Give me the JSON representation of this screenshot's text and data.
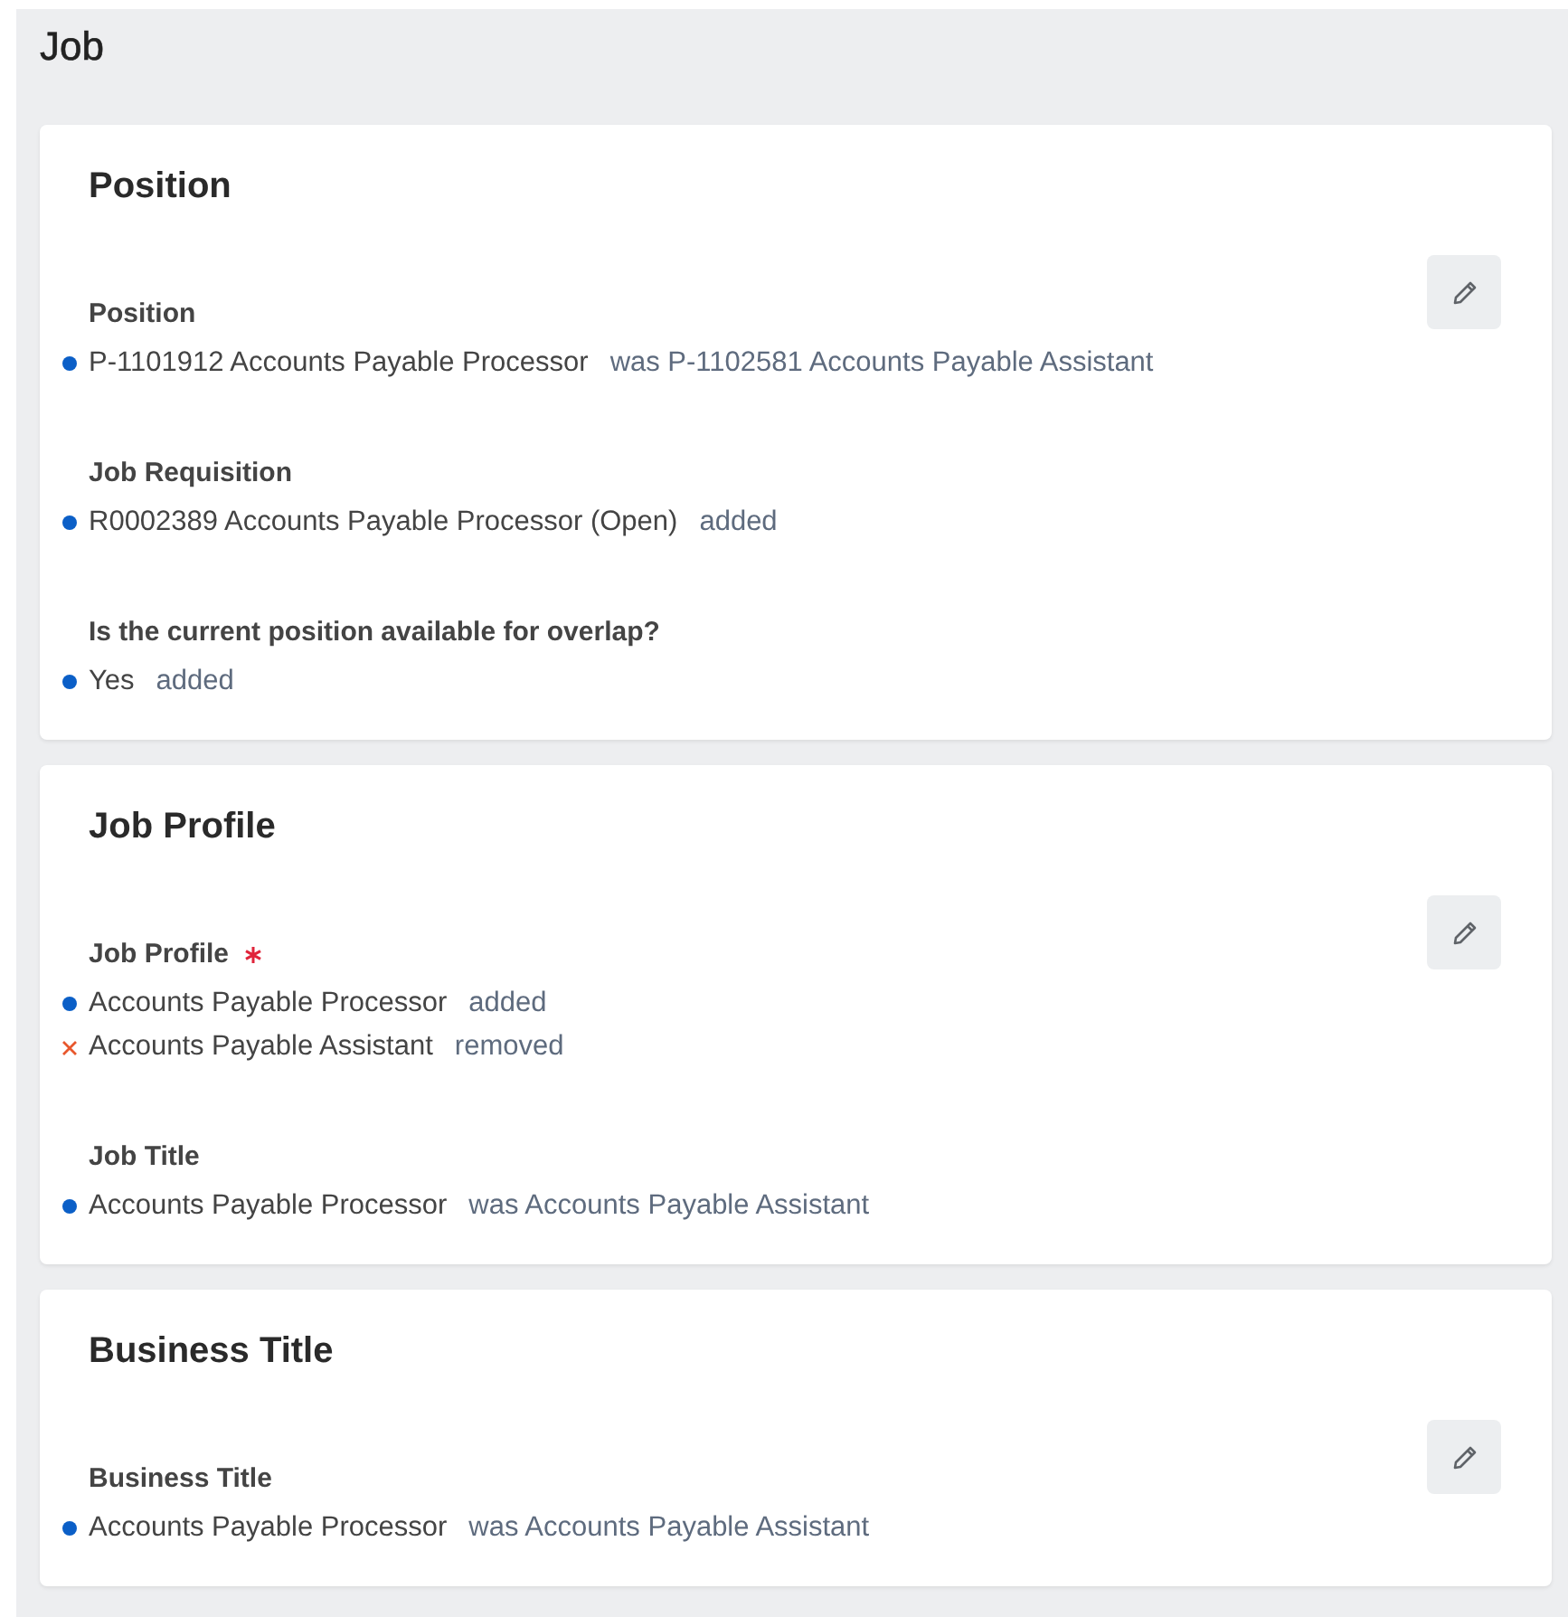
{
  "page_title": "Job",
  "sections": [
    {
      "title": "Position",
      "fields": [
        {
          "label": "Position",
          "required": false,
          "values": [
            {
              "kind": "changed",
              "value": "P-1101912 Accounts Payable Processor",
              "note": "was P-1102581 Accounts Payable Assistant"
            }
          ]
        },
        {
          "label": "Job Requisition",
          "required": false,
          "values": [
            {
              "kind": "changed",
              "value": "R0002389 Accounts Payable Processor (Open)",
              "note": "added"
            }
          ]
        },
        {
          "label": "Is the current position available for overlap?",
          "required": false,
          "values": [
            {
              "kind": "changed",
              "value": "Yes",
              "note": "added"
            }
          ]
        }
      ]
    },
    {
      "title": "Job Profile",
      "fields": [
        {
          "label": "Job Profile",
          "required": true,
          "values": [
            {
              "kind": "changed",
              "value": "Accounts Payable Processor",
              "note": "added"
            },
            {
              "kind": "removed",
              "value": "Accounts Payable Assistant",
              "note": "removed"
            }
          ]
        },
        {
          "label": "Job Title",
          "required": false,
          "values": [
            {
              "kind": "changed",
              "value": "Accounts Payable Processor",
              "note": "was Accounts Payable Assistant"
            }
          ]
        }
      ]
    },
    {
      "title": "Business Title",
      "fields": [
        {
          "label": "Business Title",
          "required": false,
          "values": [
            {
              "kind": "changed",
              "value": "Accounts Payable Processor",
              "note": "was Accounts Payable Assistant"
            }
          ]
        }
      ]
    }
  ]
}
